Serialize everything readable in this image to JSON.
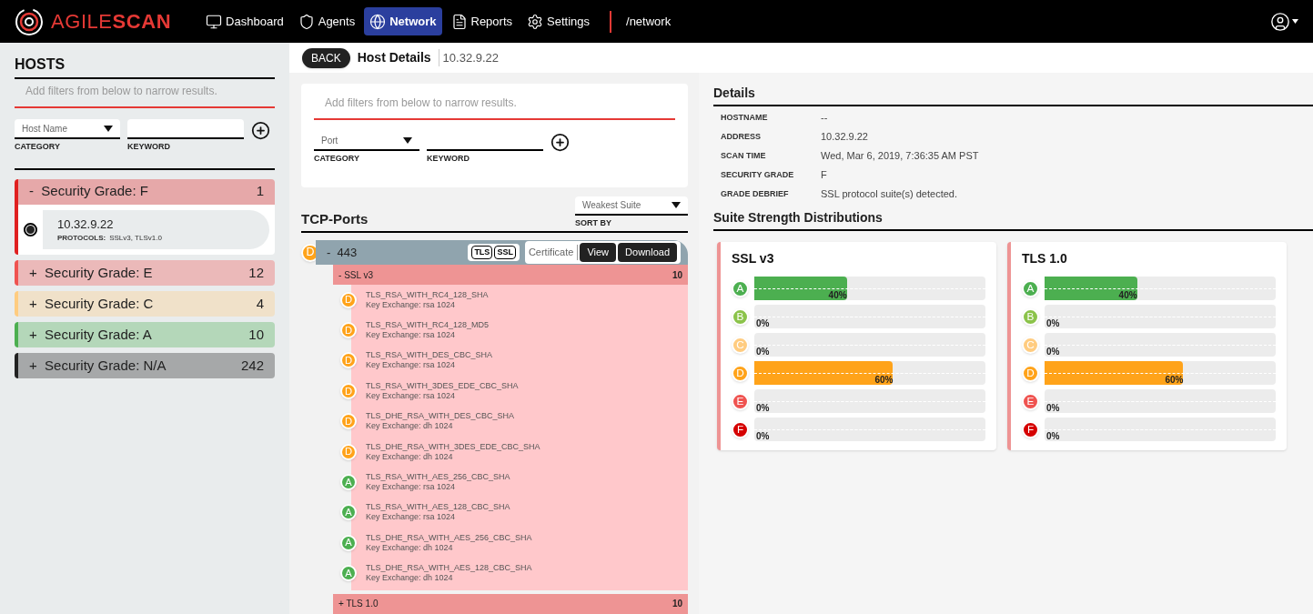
{
  "topbar": {
    "logo": "AGILE**SCAN**",
    "nav": [
      {
        "label": "Dashboard",
        "selected": false
      },
      {
        "label": "Agents",
        "selected": false
      },
      {
        "label": "Network",
        "selected": true
      },
      {
        "label": "Reports",
        "selected": false
      },
      {
        "label": "Settings",
        "selected": false
      }
    ],
    "path": "/network"
  },
  "hosts": {
    "title": "HOSTS",
    "filter_hint": "Add filters from below to narrow results.",
    "category": {
      "value": "Host Name",
      "label": "CATEGORY"
    },
    "keyword": {
      "label": "KEYWORD"
    },
    "groups": [
      {
        "sign": "-",
        "label": "Security Grade: F",
        "count": "1",
        "color": "#e02020",
        "expanded": true,
        "hosts": [
          {
            "address": "10.32.9.22",
            "protocols_label": "PROTOCOLS:",
            "protocols": "SSLv3, TLSv1.0",
            "selected": true
          }
        ]
      },
      {
        "sign": "+",
        "label": "Security Grade: E",
        "count": "12",
        "color": "#ef5350",
        "expanded": false
      },
      {
        "sign": "+",
        "label": "Security Grade: C",
        "count": "4",
        "color": "#ffcc80",
        "expanded": false
      },
      {
        "sign": "+",
        "label": "Security Grade: A",
        "count": "10",
        "color": "#4caf50",
        "expanded": false
      },
      {
        "sign": "+",
        "label": "Security Grade: N/A",
        "count": "242",
        "color": "#222222",
        "expanded": false
      }
    ]
  },
  "header": {
    "back": "BACK",
    "title": "Host Details",
    "address": "10.32.9.22"
  },
  "filter": {
    "hint": "Add filters from below to narrow results.",
    "category": {
      "value": "Port",
      "label": "CATEGORY"
    },
    "keyword": {
      "label": "KEYWORD"
    }
  },
  "ports": {
    "title": "TCP-Ports",
    "sort": {
      "value": "Weakest Suite",
      "label": "SORT BY"
    },
    "items": [
      {
        "grade": "D",
        "color": "#ffa31a",
        "sign": "-",
        "port": "443",
        "tags": [
          "TLS",
          "SSL"
        ],
        "certificate": "Certificate",
        "view": "View",
        "download": "Download",
        "expanded": true,
        "protocols": [
          {
            "sign": "-",
            "name": "SSL v3",
            "count": "10",
            "expanded": true,
            "suites": [
              {
                "grade": "D",
                "color": "#ffa31a",
                "name": "TLS_RSA_WITH_RC4_128_SHA",
                "kex": "Key Exchange: rsa 1024"
              },
              {
                "grade": "D",
                "color": "#ffa31a",
                "name": "TLS_RSA_WITH_RC4_128_MD5",
                "kex": "Key Exchange: rsa 1024"
              },
              {
                "grade": "D",
                "color": "#ffa31a",
                "name": "TLS_RSA_WITH_DES_CBC_SHA",
                "kex": "Key Exchange: rsa 1024"
              },
              {
                "grade": "D",
                "color": "#ffa31a",
                "name": "TLS_RSA_WITH_3DES_EDE_CBC_SHA",
                "kex": "Key Exchange: rsa 1024"
              },
              {
                "grade": "D",
                "color": "#ffa31a",
                "name": "TLS_DHE_RSA_WITH_DES_CBC_SHA",
                "kex": "Key Exchange: dh 1024"
              },
              {
                "grade": "D",
                "color": "#ffa31a",
                "name": "TLS_DHE_RSA_WITH_3DES_EDE_CBC_SHA",
                "kex": "Key Exchange: dh 1024"
              },
              {
                "grade": "A",
                "color": "#4caf50",
                "name": "TLS_RSA_WITH_AES_256_CBC_SHA",
                "kex": "Key Exchange: rsa 1024"
              },
              {
                "grade": "A",
                "color": "#4caf50",
                "name": "TLS_RSA_WITH_AES_128_CBC_SHA",
                "kex": "Key Exchange: rsa 1024"
              },
              {
                "grade": "A",
                "color": "#4caf50",
                "name": "TLS_DHE_RSA_WITH_AES_256_CBC_SHA",
                "kex": "Key Exchange: dh 1024"
              },
              {
                "grade": "A",
                "color": "#4caf50",
                "name": "TLS_DHE_RSA_WITH_AES_128_CBC_SHA",
                "kex": "Key Exchange: dh 1024"
              }
            ]
          },
          {
            "sign": "+",
            "name": "TLS 1.0",
            "count": "10",
            "expanded": false
          }
        ]
      }
    ]
  },
  "details": {
    "title": "Details",
    "rows": [
      {
        "label": "HOSTNAME",
        "value": "--"
      },
      {
        "label": "ADDRESS",
        "value": "10.32.9.22"
      },
      {
        "label": "SCAN TIME",
        "value": "Wed, Mar 6, 2019, 7:36:35 AM PST"
      },
      {
        "label": "SECURITY GRADE",
        "value": "F"
      },
      {
        "label": "GRADE DEBRIEF",
        "value": "SSL protocol suite(s) detected."
      }
    ]
  },
  "distributions": {
    "title": "Suite Strength Distributions",
    "cards": [
      {
        "title": "SSL v3",
        "bars": [
          {
            "grade": "A",
            "color": "#4caf50",
            "level": 0.4,
            "reading": "40%"
          },
          {
            "grade": "B",
            "color": "#8bc34a",
            "reading": "0%"
          },
          {
            "grade": "C",
            "color": "#ffcc80",
            "reading": "0%"
          },
          {
            "grade": "D",
            "color": "#ffa31a",
            "level": 0.6,
            "reading": "60%"
          },
          {
            "grade": "E",
            "color": "#ef5350",
            "reading": "0%"
          },
          {
            "grade": "F",
            "color": "#d50000",
            "reading": "0%"
          }
        ]
      },
      {
        "title": "TLS 1.0",
        "bars": [
          {
            "grade": "A",
            "color": "#4caf50",
            "level": 0.4,
            "reading": "40%"
          },
          {
            "grade": "B",
            "color": "#8bc34a",
            "reading": "0%"
          },
          {
            "grade": "C",
            "color": "#ffcc80",
            "reading": "0%"
          },
          {
            "grade": "D",
            "color": "#ffa31a",
            "level": 0.6,
            "reading": "60%"
          },
          {
            "grade": "E",
            "color": "#ef5350",
            "reading": "0%"
          },
          {
            "grade": "F",
            "color": "#d50000",
            "reading": "0%"
          }
        ]
      }
    ]
  }
}
